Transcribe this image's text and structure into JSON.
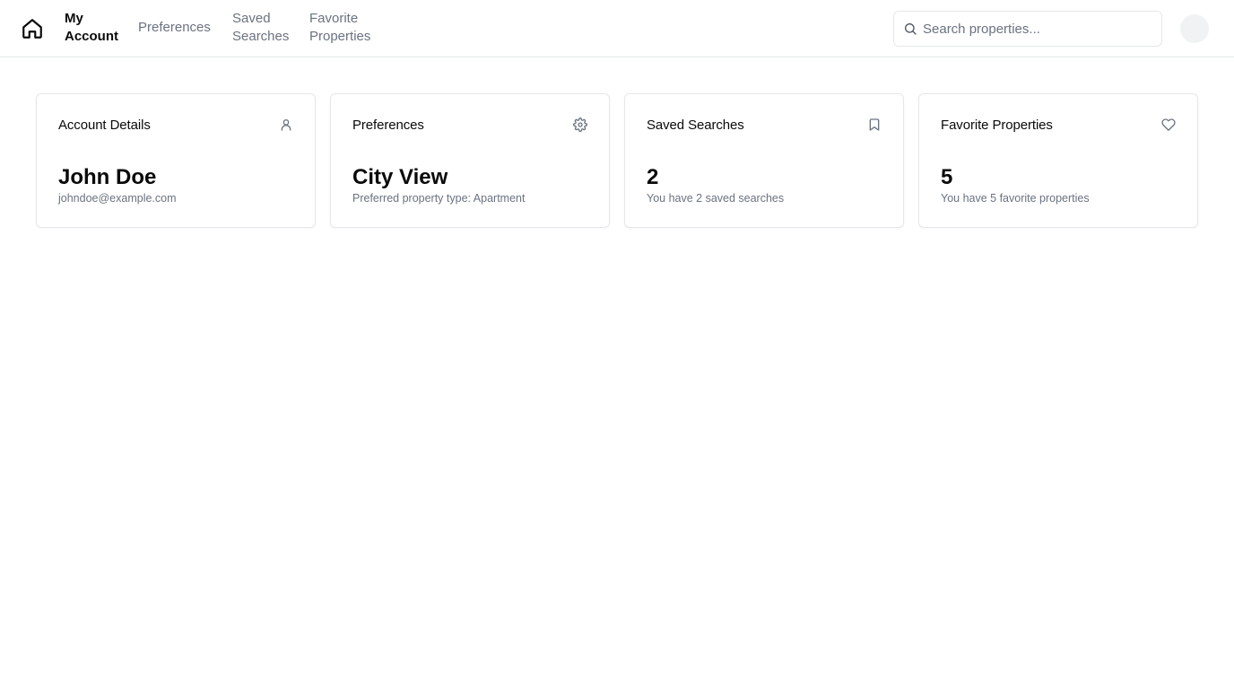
{
  "nav": {
    "home_icon": "home-icon",
    "links": [
      {
        "label": "My Account",
        "active": true
      },
      {
        "label": "Preferences",
        "active": false
      },
      {
        "label": "Saved Searches",
        "active": false
      },
      {
        "label": "Favorite Properties",
        "active": false
      }
    ]
  },
  "search": {
    "placeholder": "Search properties...",
    "value": "",
    "icon": "search-icon"
  },
  "avatar": {
    "icon": "avatar"
  },
  "cards": [
    {
      "title": "Account Details",
      "icon": "user-icon",
      "value": "John Doe",
      "subtitle": "johndoe@example.com"
    },
    {
      "title": "Preferences",
      "icon": "gear-icon",
      "value": "City View",
      "subtitle": "Preferred property type: Apartment"
    },
    {
      "title": "Saved Searches",
      "icon": "bookmark-icon",
      "value": "2",
      "subtitle": "You have 2 saved searches"
    },
    {
      "title": "Favorite Properties",
      "icon": "heart-icon",
      "value": "5",
      "subtitle": "You have 5 favorite properties"
    }
  ],
  "colors": {
    "text": "#0a0a0a",
    "muted": "#6b7280",
    "border": "#e5e7eb",
    "avatar_bg": "#f1f2f4"
  }
}
